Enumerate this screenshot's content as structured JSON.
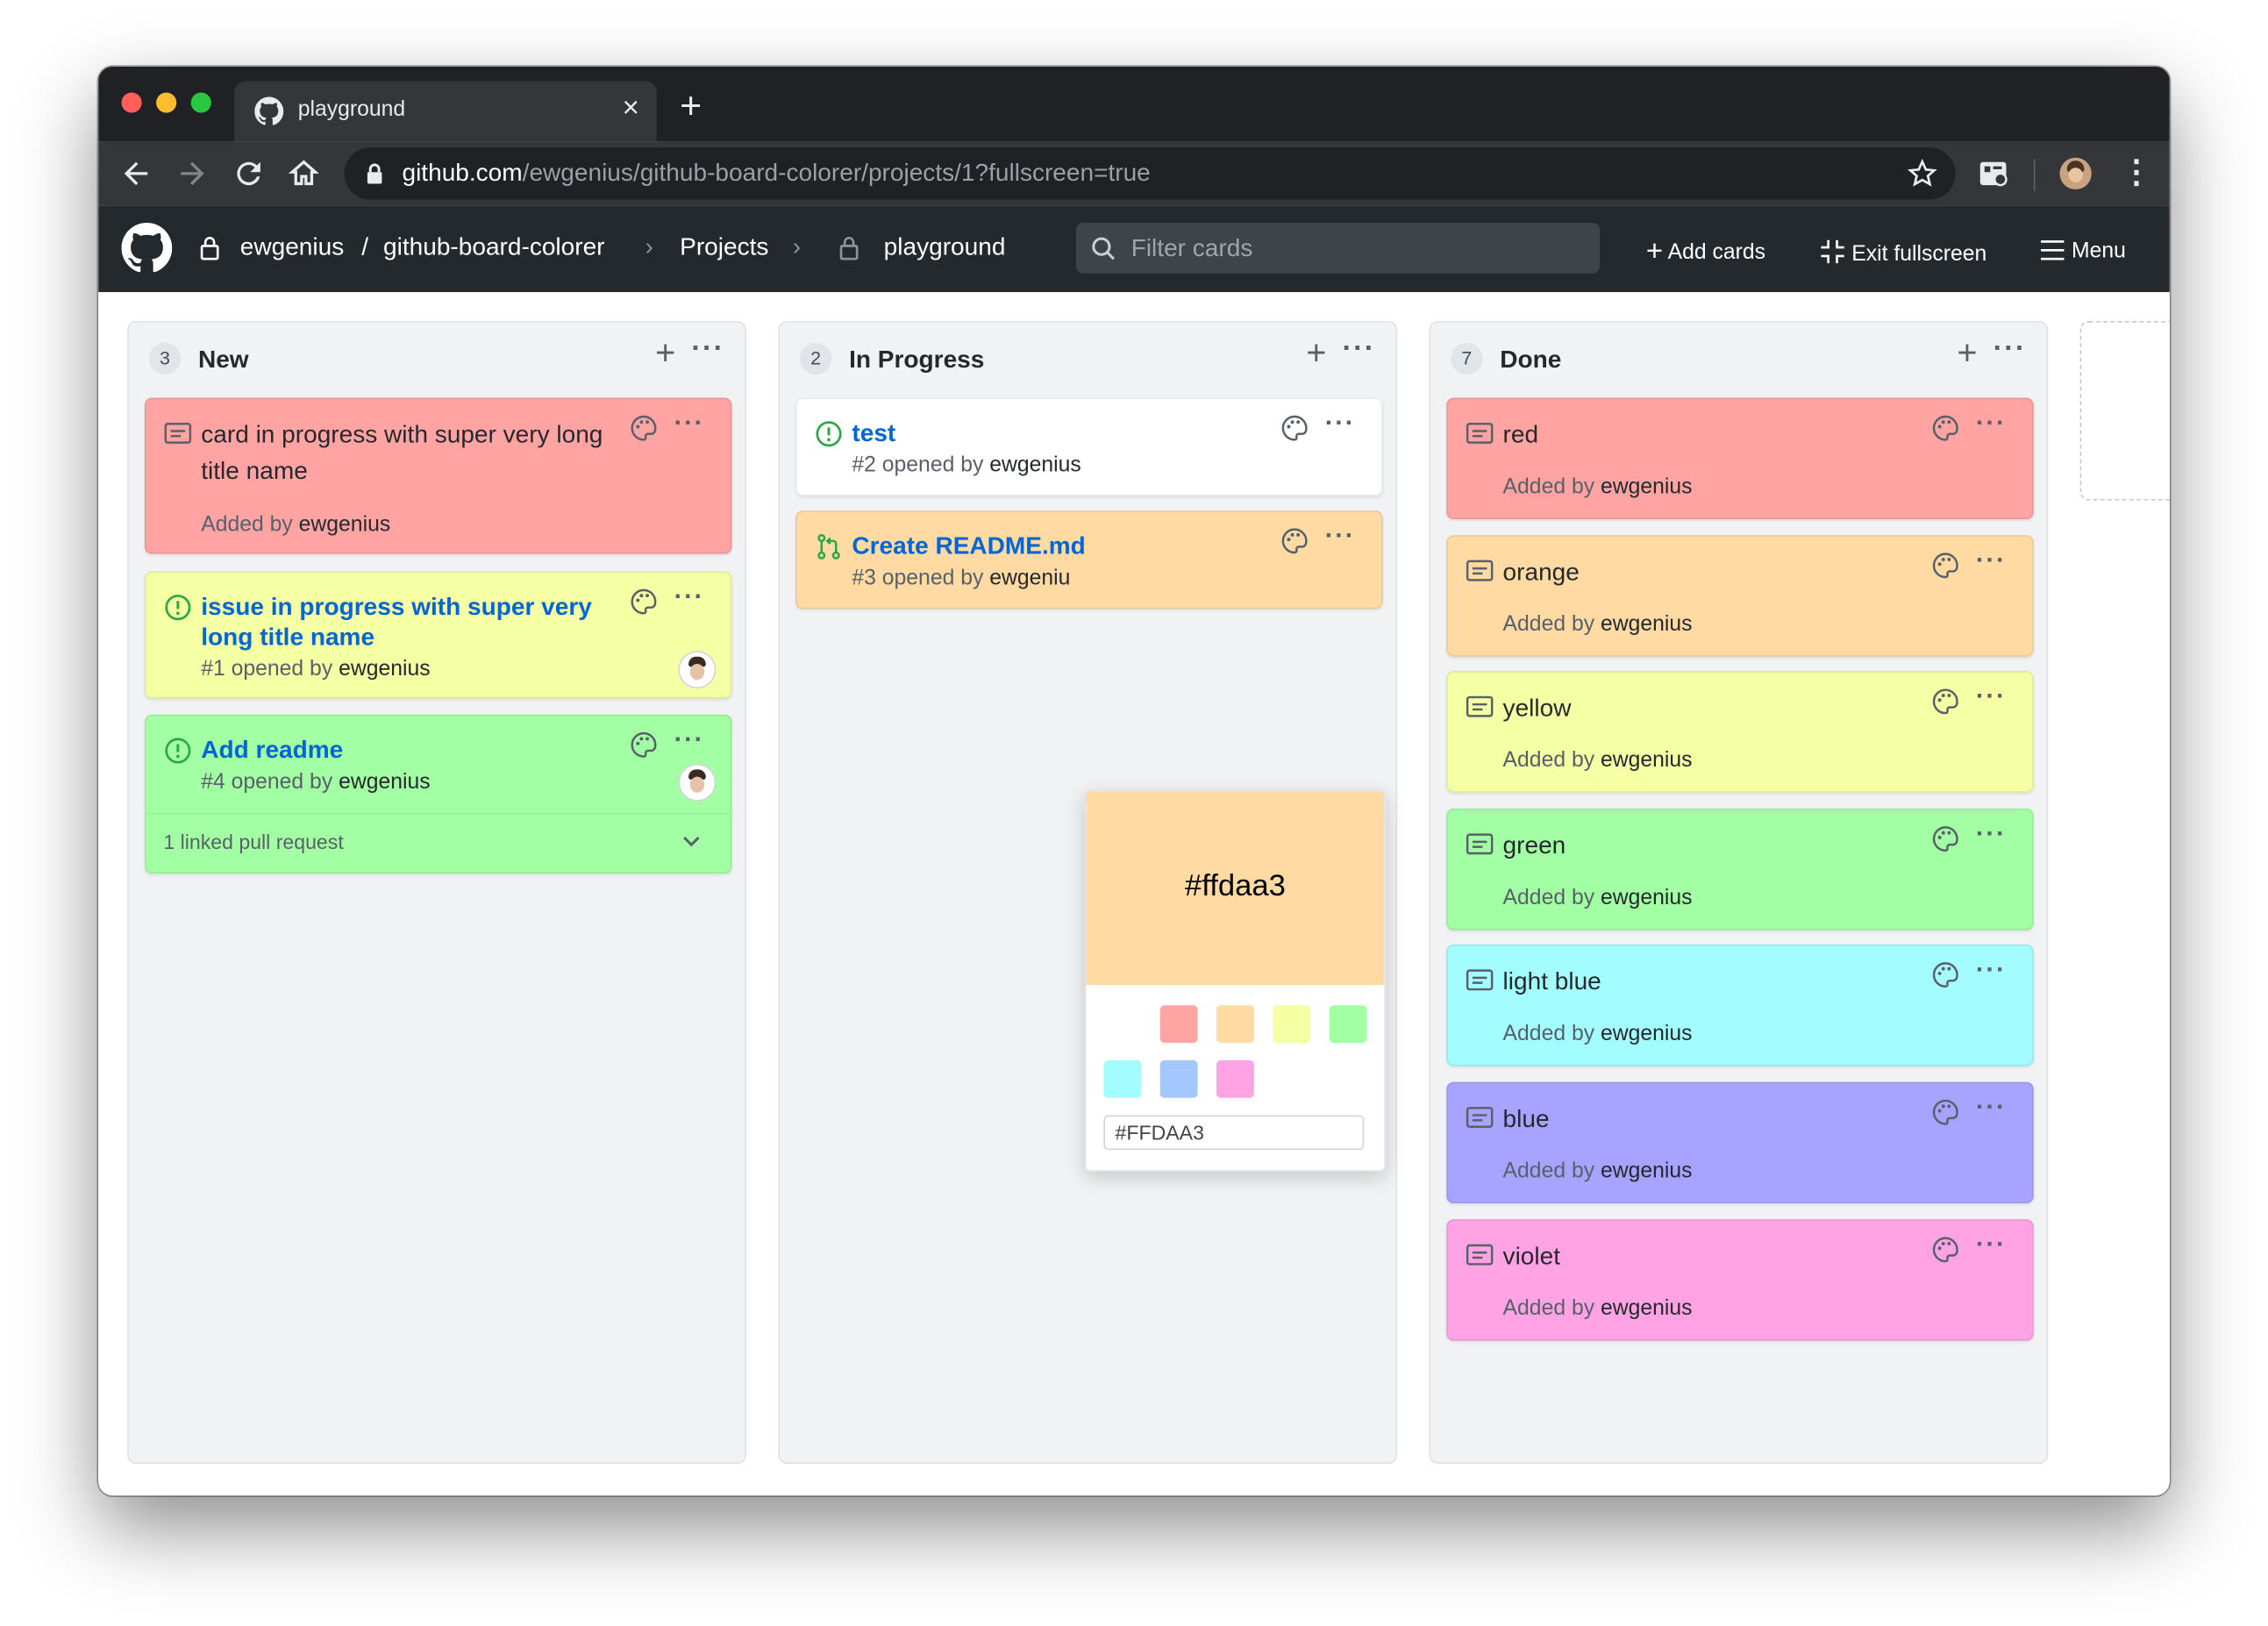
{
  "browser": {
    "tab_title": "playground",
    "url_host": "github.com",
    "url_path": "/ewgenius/github-board-colorer/projects/1?fullscreen=true"
  },
  "header": {
    "owner": "ewgenius",
    "separator": "/",
    "repo": "github-board-colorer",
    "projects": "Projects",
    "project": "playground",
    "filter_placeholder": "Filter cards",
    "add_cards": "Add cards",
    "exit_fullscreen": "Exit fullscreen",
    "menu": "Menu"
  },
  "columns": [
    {
      "count": "3",
      "title": "New",
      "cards": [
        {
          "type": "note",
          "title": "card in progress with super very long title name",
          "meta_prefix": "Added by",
          "author": "ewgenius",
          "color": "#ffa3a3"
        },
        {
          "type": "issue",
          "title": "issue in progress with super very long title name",
          "meta_prefix": "#1 opened by",
          "author": "ewgenius",
          "color": "#f5ffa3"
        },
        {
          "type": "issue",
          "title": "Add readme",
          "meta_prefix": "#4 opened by",
          "author": "ewgenius",
          "color": "#a3ffa3",
          "linked": "1 linked pull request"
        }
      ]
    },
    {
      "count": "2",
      "title": "In Progress",
      "cards": [
        {
          "type": "issue",
          "title": "test",
          "meta_prefix": "#2 opened by",
          "author": "ewgenius",
          "color": "#ffffff"
        },
        {
          "type": "pr",
          "title": "Create README.md",
          "meta_prefix": "#3 opened by",
          "author": "ewgeniu",
          "color": "#ffdaa3"
        }
      ]
    },
    {
      "count": "7",
      "title": "Done",
      "cards": [
        {
          "type": "note",
          "title": "red",
          "meta_prefix": "Added by",
          "author": "ewgenius",
          "color": "#ffa3a3"
        },
        {
          "type": "note",
          "title": "orange",
          "meta_prefix": "Added by",
          "author": "ewgenius",
          "color": "#ffdaa3"
        },
        {
          "type": "note",
          "title": "yellow",
          "meta_prefix": "Added by",
          "author": "ewgenius",
          "color": "#f5ffa3"
        },
        {
          "type": "note",
          "title": "green",
          "meta_prefix": "Added by",
          "author": "ewgenius",
          "color": "#a3ffa3"
        },
        {
          "type": "note",
          "title": "light blue",
          "meta_prefix": "Added by",
          "author": "ewgenius",
          "color": "#a3fdff"
        },
        {
          "type": "note",
          "title": "blue",
          "meta_prefix": "Added by",
          "author": "ewgenius",
          "color": "#a7a3ff"
        },
        {
          "type": "note",
          "title": "violet",
          "meta_prefix": "Added by",
          "author": "ewgenius",
          "color": "#ffa3e4"
        }
      ]
    }
  ],
  "color_picker": {
    "preview": "#ffdaa3",
    "input_value": "#FFDAA3",
    "swatches": [
      "#ffa3a3",
      "#ffdaa3",
      "#f5ffa3",
      "#a3ffa3",
      "#a3fdff",
      "#a3c8ff",
      "#ffa3e4"
    ]
  }
}
